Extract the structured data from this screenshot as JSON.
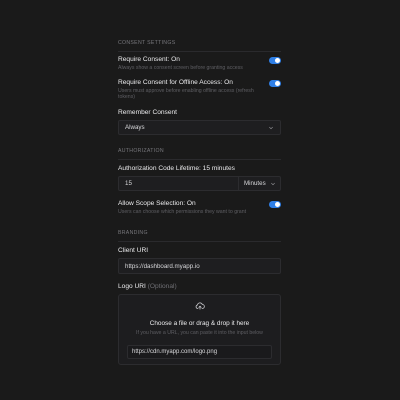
{
  "consent": {
    "header": "CONSENT SETTINGS",
    "require_consent": {
      "label": "Require Consent: On",
      "description": "Always show a consent screen before granting access"
    },
    "offline_access": {
      "label": "Require Consent for Offline Access: On",
      "description": "Users must approve before enabling offline access (refresh tokens)"
    },
    "remember": {
      "label": "Remember Consent",
      "value": "Always"
    }
  },
  "authorization": {
    "header": "AUTHORIZATION",
    "code_lifetime": {
      "label": "Authorization Code Lifetime: 15 minutes",
      "value": "15",
      "unit": "Minutes"
    },
    "scope_selection": {
      "label": "Allow Scope Selection: On",
      "description": "Users can choose which permissions they want to grant"
    }
  },
  "branding": {
    "header": "BRANDING",
    "client_uri": {
      "label": "Client URI",
      "value": "https://dashboard.myapp.io"
    },
    "logo_uri": {
      "label": "Logo URI",
      "optional": "(Optional)",
      "dropzone_title": "Choose a file or drag & drop it here",
      "dropzone_subtitle": "If you have a URL, you can paste it into the input below",
      "value": "https://cdn.myapp.com/logo.png"
    }
  },
  "colors": {
    "background": "#1a1a1a",
    "toggle_on": "#2f7fe6"
  },
  "icons": {
    "toggle_knob": "toggle-knob-icon",
    "chevron": "chevron-down-icon",
    "upload": "cloud-upload-icon"
  }
}
